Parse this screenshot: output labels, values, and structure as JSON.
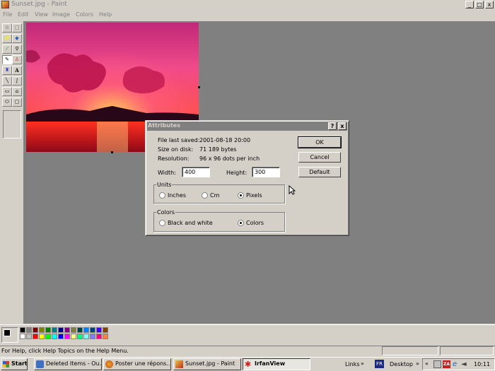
{
  "window": {
    "title": "Sunset.jpg - Paint",
    "minimize": "_",
    "maximize": "□",
    "close": "x"
  },
  "menu": [
    "File",
    "Edit",
    "View",
    "Image",
    "Colors",
    "Help"
  ],
  "toolbox": {
    "tools": [
      "free-select",
      "rect-select",
      "eraser",
      "fill",
      "eyedropper",
      "magnifier",
      "pencil",
      "brush",
      "airbrush",
      "text",
      "line",
      "curve",
      "rectangle",
      "polygon",
      "ellipse",
      "rounded-rect"
    ]
  },
  "palette": {
    "colors": [
      "#000000",
      "#808080",
      "#800000",
      "#808000",
      "#008000",
      "#008080",
      "#000080",
      "#800080",
      "#808040",
      "#004040",
      "#0080ff",
      "#004080",
      "#4000ff",
      "#804000",
      "#ffffff",
      "#c0c0c0",
      "#ff0000",
      "#ffff00",
      "#00ff00",
      "#00ffff",
      "#0000ff",
      "#ff00ff",
      "#ffff80",
      "#00ff80",
      "#80ffff",
      "#8080ff",
      "#ff0080",
      "#ff8040"
    ]
  },
  "status": {
    "help_text": "For Help, click Help Topics on the Help Menu."
  },
  "dialog": {
    "title": "Attributes",
    "help_btn": "?",
    "close_btn": "x",
    "file_last_saved_label": "File last saved:",
    "file_last_saved_value": "2001-08-18 20:00",
    "size_on_disk_label": "Size on disk:",
    "size_on_disk_value": "71 189 bytes",
    "resolution_label": "Resolution:",
    "resolution_value": "96 x 96 dots per inch",
    "width_label": "Width:",
    "width_value": "400",
    "height_label": "Height:",
    "height_value": "300",
    "units_label": "Units",
    "units_options": [
      "Inches",
      "Cm",
      "Pixels"
    ],
    "units_selected": "Pixels",
    "colors_label": "Colors",
    "colors_options": [
      "Black and white",
      "Colors"
    ],
    "colors_selected": "Colors",
    "ok": "OK",
    "cancel": "Cancel",
    "default": "Default"
  },
  "taskbar": {
    "start": "Start",
    "buttons": [
      {
        "label": "Deleted Items - Ou...",
        "active": false
      },
      {
        "label": "Poster une répons...",
        "active": false
      },
      {
        "label": "Sunset.jpg - Paint",
        "active": false
      },
      {
        "label": "IrfanView",
        "active": true
      }
    ],
    "links": "Links",
    "lang": "FR",
    "desktop": "Desktop",
    "clock": "10:11"
  }
}
